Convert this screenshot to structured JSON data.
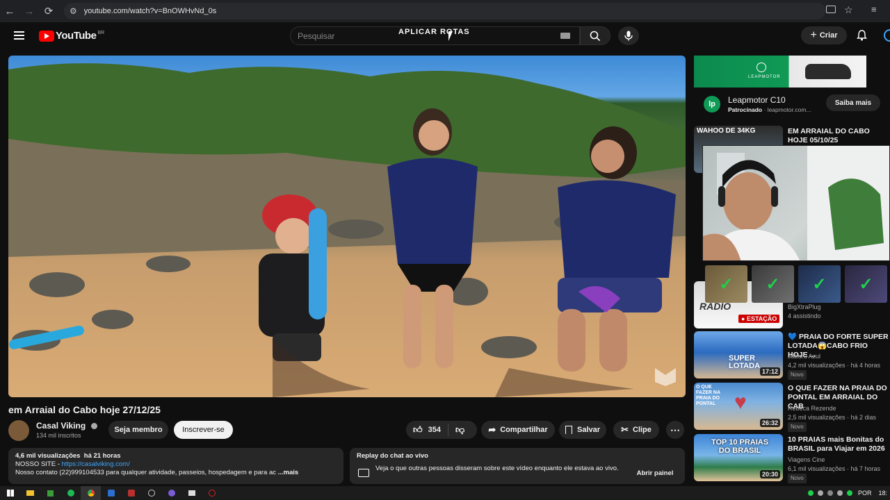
{
  "browser": {
    "url": "youtube.com/watch?v=BnOWHvNd_0s"
  },
  "yt": {
    "logo_text": "YouTube",
    "region": "BR",
    "search_placeholder": "Pesquisar",
    "overlay_text": "APLICAR ROTAS",
    "create_label": "Criar"
  },
  "video": {
    "title": "em Arraial do Cabo hoje 27/12/25",
    "channel": "Casal Viking",
    "subscribers": "134 mil inscritos",
    "join_label": "Seja membro",
    "subscribe_label": "Inscrever-se",
    "likes": "354",
    "share_label": "Compartilhar",
    "save_label": "Salvar",
    "clip_label": "Clipe",
    "views": "4,6 mil visualizações",
    "age": "há 21 horas",
    "site_label": "NOSSO SITE - ",
    "site_link": "https://casalviking.com/",
    "contact": "Nosso contato (22)999104533 para qualquer atividade, passeios, hospedagem e para ac",
    "more_label": "...mais"
  },
  "chat_replay": {
    "title": "Replay do chat ao vivo",
    "text": "Veja o que outras pessoas disseram sobre este vídeo enquanto ele estava ao vivo.",
    "button": "Abrir painel"
  },
  "ad": {
    "brand_in_banner": "LEAPMOTOR",
    "title": "Leapmotor C10",
    "sponsored": "Patrocinado",
    "domain": "leapmotor.com...",
    "cta": "Saiba mais"
  },
  "recommendations": [
    {
      "thumb_text": "WAHOO DE 34KG",
      "title": "EM ARRAIAL DO CABO HOJE 05/10/25",
      "channel": "",
      "meta": "",
      "badge": ""
    },
    {
      "thumb_text": "RADIO",
      "title": "",
      "channel": "BigXtraPlug",
      "meta": "4 assistindo",
      "badge": "ESTAÇÃO"
    },
    {
      "thumb_text": "SUPER LOTADA",
      "duration": "17:12",
      "title": "💙 PRAIA DO FORTE SUPER LOTADA😱CABO FRIO HOJE ...",
      "channel": "Jaburu Azul",
      "meta": "4,2 mil visualizações · há 4 horas",
      "badge": "Novo"
    },
    {
      "thumb_text": "O QUE FAZER NA PRAIA DO PONTAL",
      "duration": "26:32",
      "title": "O QUE FAZER NA PRAIA DO PONTAL EM ARRAIAL DO CAB",
      "channel": "Rebeca Rezende",
      "meta": "2,5 mil visualizações · há 2 dias",
      "badge": "Novo"
    },
    {
      "thumb_text": "TOP 10 PRAIAS DO BRASIL",
      "duration": "20:30",
      "title": "10 PRAIAS mais Bonitas do BRASIL para Viajar em 2026",
      "channel": "Viagens Cine",
      "meta": "6,1 mil visualizações · há 7 horas",
      "badge": "Novo"
    }
  ],
  "taskbar": {
    "lang": "POR",
    "time": "18:"
  },
  "colors": {
    "yt_red": "#ff0000",
    "accent_blue": "#3ea6ff",
    "ad_green": "#0f9a55",
    "check_green": "#1ed04b"
  }
}
